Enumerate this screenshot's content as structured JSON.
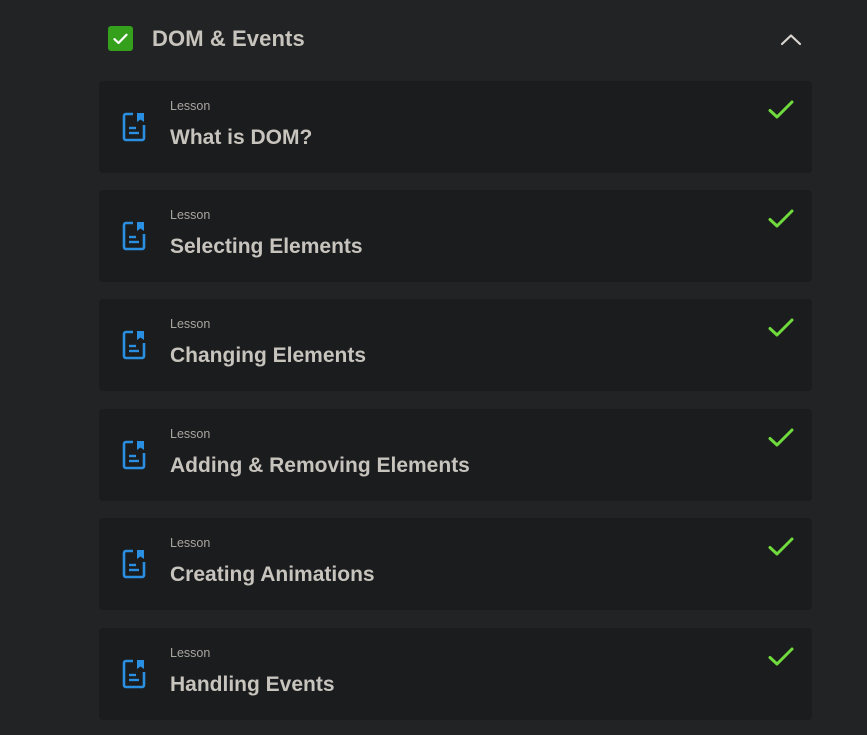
{
  "section": {
    "title": "DOM & Events",
    "check_icon": "check-icon",
    "collapse_icon": "chevron-up-icon"
  },
  "colors": {
    "background": "#222324",
    "card": "#1b1c1e",
    "section_check": "#35a01c",
    "lesson_check": "#6fdb3c",
    "lesson_icon": "#2a8fe0",
    "text_primary": "#c7c3bd",
    "text_secondary": "#a9a59f"
  },
  "lessons": [
    {
      "type": "Lesson",
      "title": "What is DOM?",
      "icon": "document-icon",
      "completed_icon": "check-icon"
    },
    {
      "type": "Lesson",
      "title": "Selecting Elements",
      "icon": "document-icon",
      "completed_icon": "check-icon"
    },
    {
      "type": "Lesson",
      "title": "Changing Elements",
      "icon": "document-icon",
      "completed_icon": "check-icon"
    },
    {
      "type": "Lesson",
      "title": "Adding & Removing Elements",
      "icon": "document-icon",
      "completed_icon": "check-icon"
    },
    {
      "type": "Lesson",
      "title": "Creating Animations",
      "icon": "document-icon",
      "completed_icon": "check-icon"
    },
    {
      "type": "Lesson",
      "title": "Handling Events",
      "icon": "document-icon",
      "completed_icon": "check-icon"
    }
  ]
}
